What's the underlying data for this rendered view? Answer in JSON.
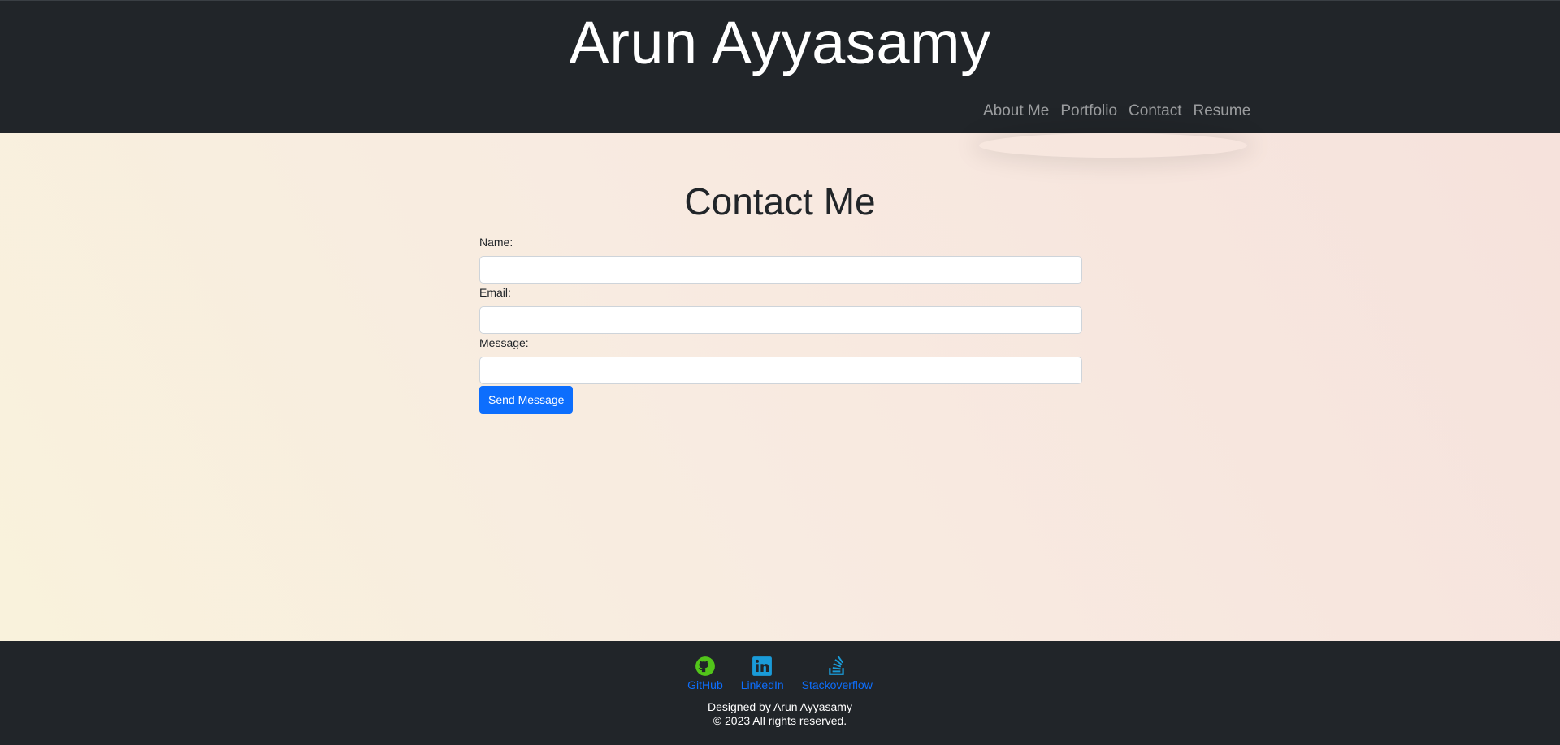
{
  "header": {
    "title": "Arun Ayyasamy",
    "nav": [
      {
        "label": "About Me"
      },
      {
        "label": "Portfolio"
      },
      {
        "label": "Contact"
      },
      {
        "label": "Resume"
      }
    ]
  },
  "contact": {
    "title": "Contact Me",
    "fields": {
      "name": {
        "label": "Name:",
        "value": ""
      },
      "email": {
        "label": "Email:",
        "value": ""
      },
      "message": {
        "label": "Message:",
        "value": ""
      }
    },
    "submit_label": "Send Message"
  },
  "footer": {
    "links": [
      {
        "label": "GitHub",
        "icon": "github-icon",
        "color": "#52c41a"
      },
      {
        "label": "LinkedIn",
        "icon": "linkedin-icon",
        "color": "#1a9bd8"
      },
      {
        "label": "Stackoverflow",
        "icon": "stackoverflow-icon",
        "color": "#1a9bd8"
      }
    ],
    "credit_line1": "Designed by Arun Ayyasamy",
    "credit_line2": "© 2023 All rights reserved."
  },
  "colors": {
    "header_bg": "#212529",
    "accent": "#0d6efd",
    "nav_text": "rgba(255,255,255,0.55)"
  }
}
